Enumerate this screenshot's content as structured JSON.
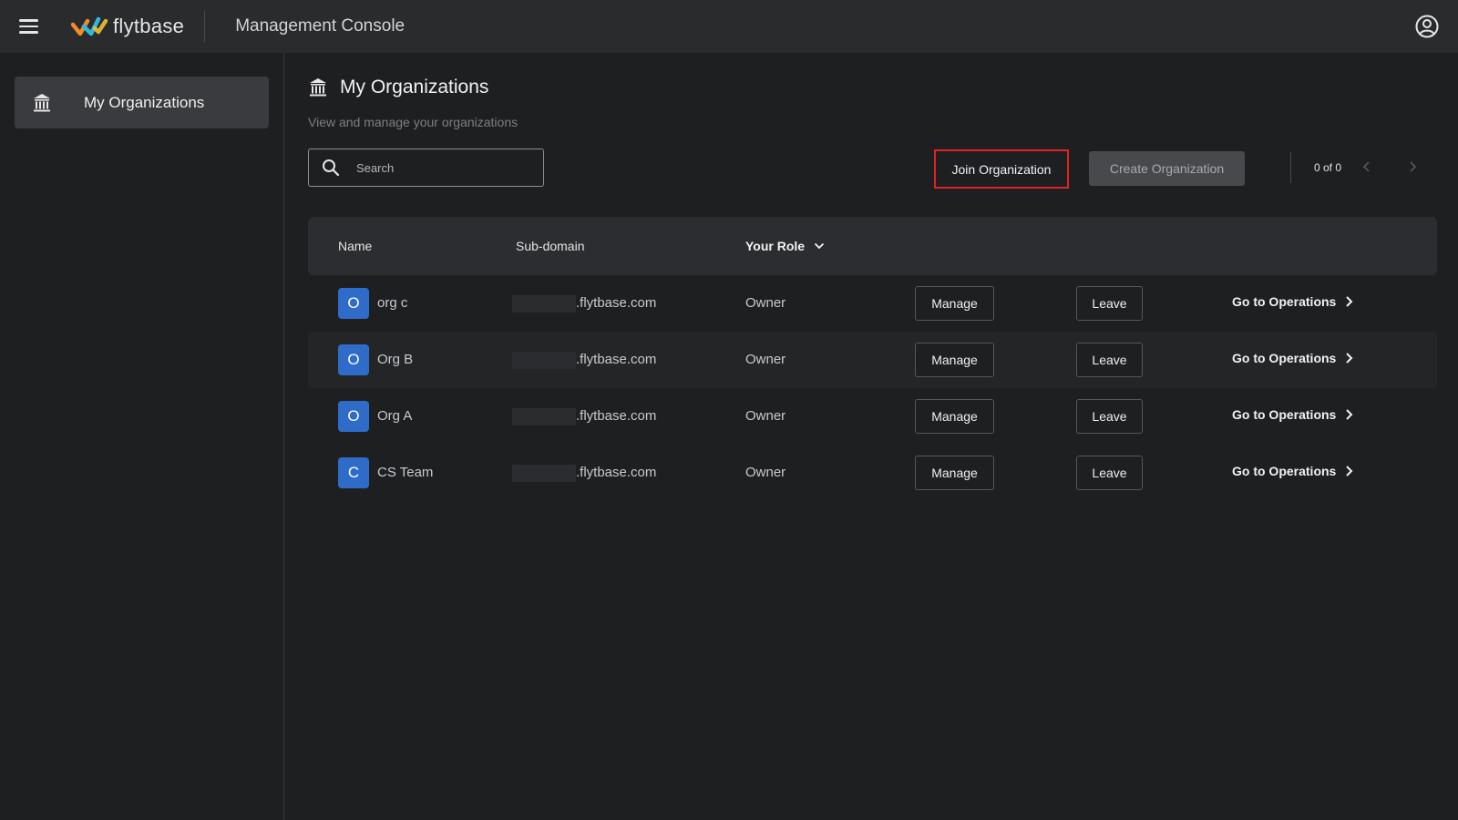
{
  "app": {
    "brand": "flytbase",
    "title": "Management Console",
    "colors": {
      "accent": "#2f6cc9",
      "highlight": "#e02424",
      "background": "#1e1f21"
    }
  },
  "sidebar": {
    "items": [
      {
        "label": "My Organizations",
        "icon": "bank-icon",
        "active": true
      }
    ]
  },
  "page": {
    "title": "My Organizations",
    "subtitle": "View and manage your organizations"
  },
  "toolbar": {
    "search_placeholder": "Search",
    "join_label": "Join Organization",
    "create_label": "Create Organization",
    "pager_text": "0 of 0"
  },
  "table": {
    "columns": [
      "Name",
      "Sub-domain",
      "Your Role"
    ],
    "rows": [
      {
        "initial": "O",
        "name": "org c",
        "subdomain": ".flytbase.com",
        "role": "Owner",
        "manage": "Manage",
        "leave": "Leave",
        "go": "Go to Operations"
      },
      {
        "initial": "O",
        "name": "Org B",
        "subdomain": ".flytbase.com",
        "role": "Owner",
        "manage": "Manage",
        "leave": "Leave",
        "go": "Go to Operations"
      },
      {
        "initial": "O",
        "name": "Org A",
        "subdomain": ".flytbase.com",
        "role": "Owner",
        "manage": "Manage",
        "leave": "Leave",
        "go": "Go to Operations"
      },
      {
        "initial": "C",
        "name": "CS Team",
        "subdomain": ".flytbase.com",
        "role": "Owner",
        "manage": "Manage",
        "leave": "Leave",
        "go": "Go to Operations"
      }
    ]
  }
}
